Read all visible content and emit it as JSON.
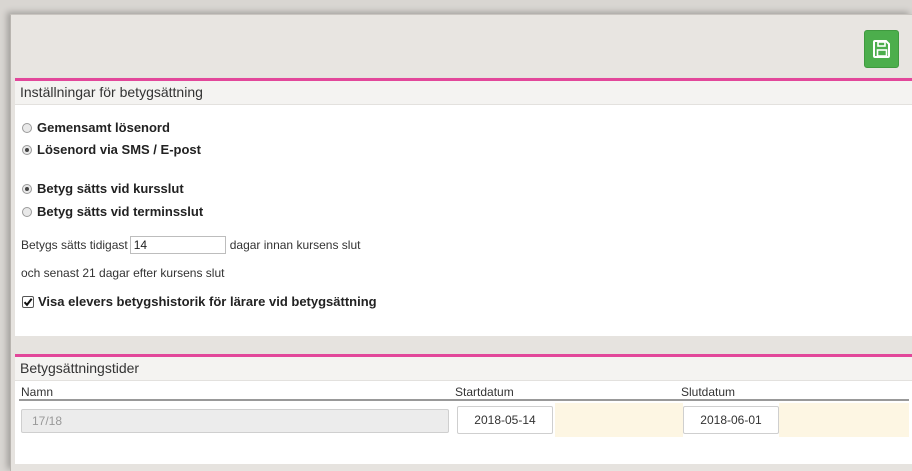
{
  "toolbar": {
    "save_icon": "floppy-disk-icon",
    "accent_color": "#4cae4c"
  },
  "settings": {
    "title": "Inställningar för betygsättning",
    "password_options": [
      {
        "label": "Gemensamt lösenord",
        "checked": false
      },
      {
        "label": "Lösenord via SMS / E-post",
        "checked": true
      }
    ],
    "grading_options": [
      {
        "label": "Betyg sätts vid kursslut",
        "checked": true
      },
      {
        "label": "Betyg sätts vid terminsslut",
        "checked": false
      }
    ],
    "earliest_prefix": "Betygs sätts tidigast",
    "earliest_value": "14",
    "earliest_suffix": "dagar innan kursens slut",
    "latest_text": "och senast 21 dagar efter kursens slut",
    "history_checkbox": {
      "label": "Visa elevers betygshistorik för lärare vid betygsättning",
      "checked": true
    }
  },
  "times": {
    "title": "Betygsättningstider",
    "columns": {
      "name": "Namn",
      "start": "Startdatum",
      "end": "Slutdatum"
    },
    "rows": [
      {
        "name": "17/18",
        "start": "2018-05-14",
        "end": "2018-06-01"
      }
    ]
  },
  "colors": {
    "section_border": "#e2479a",
    "row_highlight": "#fdf6e3"
  }
}
